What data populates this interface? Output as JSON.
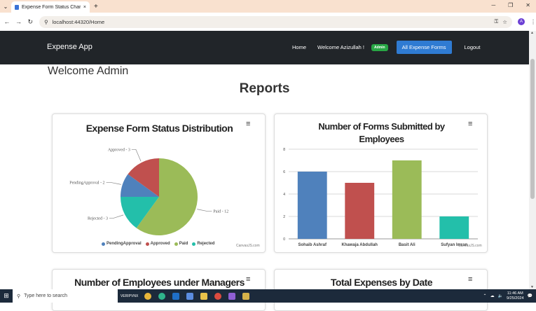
{
  "browser": {
    "tab_title": "Expense Form Status Charts",
    "tab_close": "×",
    "new_tab": "+",
    "url": "localhost:44320/Home",
    "profile_initial": "A"
  },
  "nav": {
    "brand": "Expense App",
    "home": "Home",
    "welcome_user": "Welcome Azizullah !",
    "role_badge": "Admin",
    "all_forms": "All Expense Forms",
    "logout": "Logout"
  },
  "page": {
    "welcome": "Welcome Admin",
    "title": "Reports"
  },
  "charts": {
    "credit": "CanvasJS.com",
    "menu_glyph": "≡",
    "pie_title": "Expense Form Status Distribution",
    "bar_title_line1": "Number of Forms Submitted by",
    "bar_title_line2": "Employees",
    "managers_title": "Number of Employees under Managers",
    "expenses_title": "Total Expenses by Date"
  },
  "chart_data": [
    {
      "type": "pie",
      "title": "Expense Form Status Distribution",
      "slices": [
        {
          "name": "PendingApproval",
          "value": 2,
          "label": "PendingApproval - 2",
          "color": "#4f81bc"
        },
        {
          "name": "Approved",
          "value": 3,
          "label": "Approved - 3",
          "color": "#c0504e"
        },
        {
          "name": "Paid",
          "value": 12,
          "label": "Paid - 12",
          "color": "#9bbb58"
        },
        {
          "name": "Rejected",
          "value": 3,
          "label": "Rejected - 3",
          "color": "#23bfaa"
        }
      ],
      "legend": "bottom"
    },
    {
      "type": "bar",
      "title": "Number of Forms Submitted by Employees",
      "categories": [
        "Sohaib Ashraf",
        "Khawaja Abdullah",
        "Basit Ali",
        "Sufyan Imran"
      ],
      "values": [
        6,
        5,
        7,
        2
      ],
      "colors": [
        "#4f81bc",
        "#c0504e",
        "#9bbb58",
        "#23bfaa"
      ],
      "ylim": [
        0,
        8
      ],
      "yticks": [
        "0",
        "2",
        "4",
        "6",
        "8"
      ],
      "grid": true
    }
  ],
  "taskbar": {
    "search_placeholder": "Type here to search",
    "vpn": "VERIPVNX",
    "time": "11:46 AM",
    "date": "9/25/2024"
  }
}
